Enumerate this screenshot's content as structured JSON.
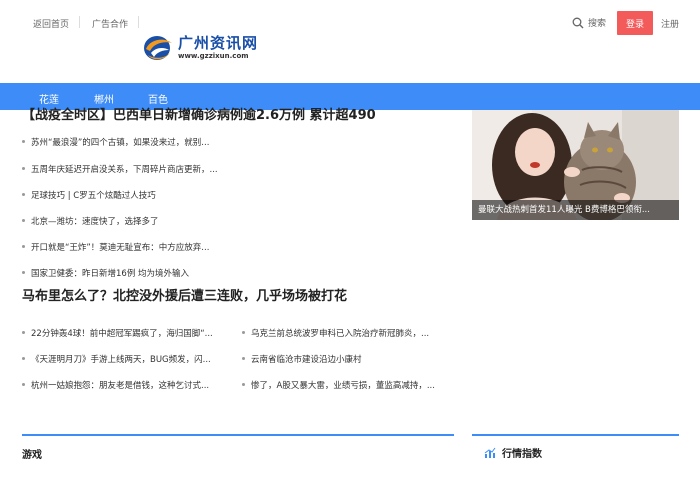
{
  "topbar": {
    "home_link": "返回首页",
    "ad_link": "广告合作",
    "search_label": "搜索",
    "login_label": "登录",
    "register_label": "注册"
  },
  "logo": {
    "title": "广州资讯网",
    "url": "www.gzzixun.com"
  },
  "nav": {
    "items": [
      "花莲",
      "郴州",
      "百色"
    ]
  },
  "section1": {
    "headline": "【战疫全时区】巴西单日新增确诊病例逾2.6万例 累计超490",
    "items": [
      "苏州“最浪漫”的四个古镇，如果没来过，就别...",
      "五周年庆延迟开启没关系，下周碎片商店更新，...",
      "足球技巧 | C罗五个炫酷过人技巧",
      "北京—潍坊：速度快了，选择多了",
      "开口就是“王炸”！莫迪无耻宣布：中方应放弃...",
      "国家卫健委：昨日新增16例 均为境外输入"
    ]
  },
  "photo": {
    "caption": "曼联大战热刺首发11人曝光 B费博格巴领衔..."
  },
  "section2": {
    "headline": "马布里怎么了？北控没外援后遭三连败，几乎场场被打花",
    "left_items": [
      "22分钟轰4球！前中超冠军踢疯了，海归国脚“...",
      "《天涯明月刀》手游上线两天，BUG频发，闪...",
      "杭州一姑娘抱怨：朋友老是借钱，这种乞讨式..."
    ],
    "right_items": [
      "乌克兰前总统波罗申科已入院治疗新冠肺炎，...",
      "云南省临沧市建设沿边小康村",
      "惨了，A股又暴大雷，业绩亏损，董监高减持，..."
    ]
  },
  "sections": {
    "games_title": "游戏",
    "market_title": "行情指数"
  },
  "colors": {
    "nav": "#3d8cf7",
    "login": "#f35b5b",
    "logo_blue": "#1a4fa8",
    "logo_orange": "#f39a1e"
  },
  "icons": {
    "search": "search-icon",
    "market": "chart-icon"
  }
}
